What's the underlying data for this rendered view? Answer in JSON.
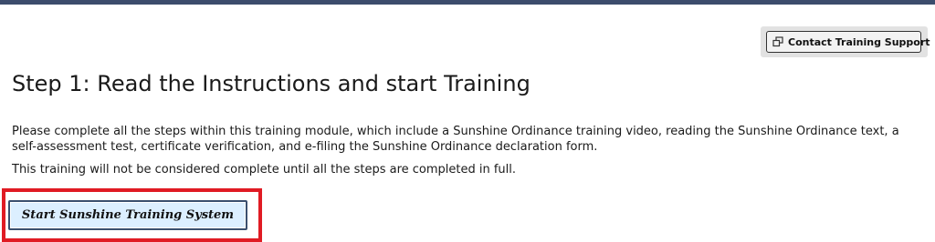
{
  "header": {
    "support_button_label": "Contact Training Support",
    "support_icon": "external-window-icon"
  },
  "step": {
    "title": "Step 1: Read the Instructions and start Training",
    "instructions": "Please complete all the steps within this training module, which include a Sunshine Ordinance training video, reading the Sunshine Ordinance text, a self-assessment test, certificate verification, and e-filing the Sunshine Ordinance declaration form.",
    "completion_note": "This training will not be considered complete until all the steps are completed in full.",
    "start_button_label": "Start Sunshine Training System"
  },
  "colors": {
    "top_bar": "#3c4c6c",
    "highlight": "#e01b24",
    "start_button_bg": "#dcefff",
    "start_button_border": "#3a4f6e"
  }
}
